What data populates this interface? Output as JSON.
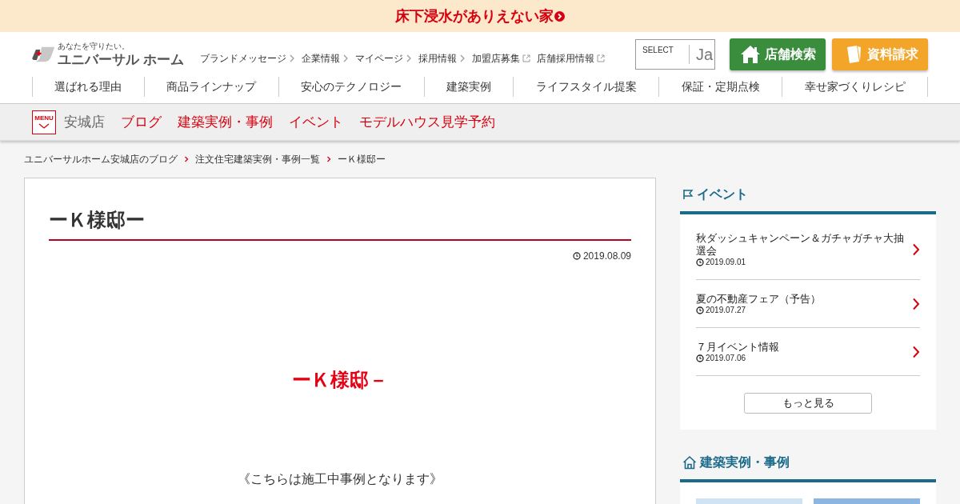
{
  "banner": {
    "text": "床下浸水がありえない家"
  },
  "header": {
    "logo": {
      "tagline": "あなたを守りたい。",
      "name": "ユニバーサル ホーム"
    },
    "utility_links": [
      {
        "label": "ブランドメッセージ",
        "kind": "internal"
      },
      {
        "label": "企業情報",
        "kind": "internal"
      },
      {
        "label": "マイページ",
        "kind": "internal"
      },
      {
        "label": "採用情報",
        "kind": "internal"
      },
      {
        "label": "加盟店募集",
        "kind": "external"
      },
      {
        "label": "店舗採用情報",
        "kind": "external"
      }
    ],
    "language_select": {
      "label": "SELECT",
      "value": "Ja"
    },
    "buttons": [
      {
        "label": "店舗検索",
        "kind": "store"
      },
      {
        "label": "資料請求",
        "kind": "brochure"
      }
    ]
  },
  "main_nav": [
    "選ばれる理由",
    "商品ラインナップ",
    "安心のテクノロジー",
    "建築実例",
    "ライフスタイル提案",
    "保証・定期点検",
    "幸せ家づくりレシピ"
  ],
  "sub_nav": {
    "menu_label": "MENU",
    "store": "安城店",
    "links": [
      "ブログ",
      "建築実例・事例",
      "イベント",
      "モデルハウス見学予約"
    ]
  },
  "breadcrumb": [
    "ユニバーサルホーム安城店のブログ",
    "注文住宅建築実例・事例一覧",
    "ーＫ様邸ー"
  ],
  "article": {
    "title": "ーＫ様邸ー",
    "date": "2019.08.09",
    "heading": "ーＫ様邸－",
    "note": "《こちらは施工中事例となります》"
  },
  "sidebar": {
    "events": {
      "title": "イベント",
      "items": [
        {
          "title": "秋ダッシュキャンペーン＆ガチャガチャ大抽選会",
          "date": "2019.09.01"
        },
        {
          "title": "夏の不動産フェア（予告）",
          "date": "2019.07.27"
        },
        {
          "title": "７月イベント情報",
          "date": "2019.07.06"
        }
      ],
      "more": "もっと見る"
    },
    "cases": {
      "title": "建築実例・事例",
      "photos": [
        {
          "kind": "photo"
        },
        {
          "kind": "photo"
        }
      ]
    }
  }
}
